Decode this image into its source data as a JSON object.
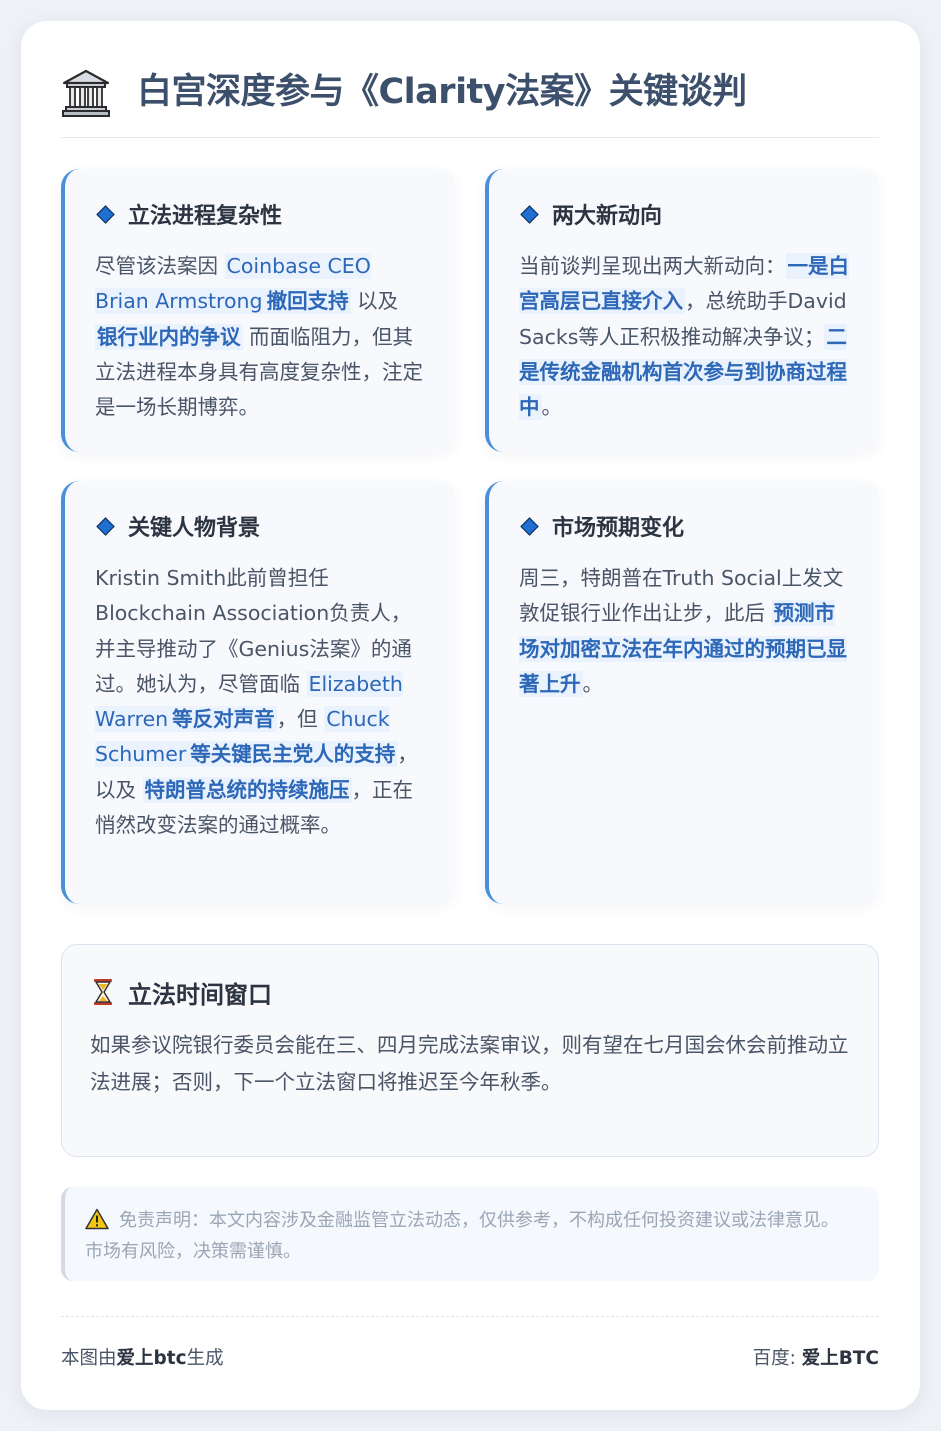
{
  "title": "白宫深度参与《Clarity法案》关键谈判",
  "sections": [
    {
      "title": "立法进程复杂性",
      "parts": [
        "尽管该法案因 ",
        "Coinbase CEO Brian Armstrong",
        "撤回支持",
        " 以及 ",
        "银行业内的争议",
        " 而面临阻力，但其立法进程本身具有高度复杂性，注定是一场长期博弈。"
      ]
    },
    {
      "title": "两大新动向",
      "parts": [
        "当前谈判呈现出两大新动向：",
        "一是白宫高层已直接介入",
        "，总统助手David Sacks等人正积极推动解决争议；",
        "二是传统金融机构首次参与到协商过程中",
        "。"
      ]
    },
    {
      "title": "关键人物背景",
      "parts": [
        "Kristin Smith此前曾担任Blockchain Association负责人，并主导推动了《Genius法案》的通过。她认为，尽管面临 ",
        "Elizabeth Warren",
        "等反对声音",
        "，但 ",
        "Chuck Schumer",
        "等关键民主党人的支持",
        "，以及 ",
        "特朗普总统的持续施压",
        "，正在悄然改变法案的通过概率。"
      ]
    },
    {
      "title": "市场预期变化",
      "parts": [
        "周三，特朗普在Truth Social上发文敦促银行业作出让步，此后 ",
        "预测市场对加密立法在年内通过的预期已显著上升",
        "。"
      ]
    }
  ],
  "window": {
    "title": "立法时间窗口",
    "text": "如果参议院银行委员会能在三、四月完成法案审议，则有望在七月国会休会前推动立法进展；否则，下一个立法窗口将推迟至今年秋季。"
  },
  "disclaimer": "免责声明：本文内容涉及金融监管立法动态，仅供参考，不构成任何投资建议或法律意见。市场有风险，决策需谨慎。",
  "footer": {
    "left_prefix": "本图由",
    "left_brand": "爱上btc",
    "left_suffix": "生成",
    "right_prefix": "百度: ",
    "right_brand": "爱上BTC"
  },
  "colors": {
    "accent": "#4a8fd9",
    "highlight_text": "#2c67b8",
    "highlight_bg": "#e9f2fd",
    "diamond": "#1f6fd1"
  },
  "icons": {
    "header": "classical-building-icon",
    "section_bullet": "blue-diamond-icon",
    "window": "hourglass-icon",
    "disclaimer": "warning-icon"
  }
}
